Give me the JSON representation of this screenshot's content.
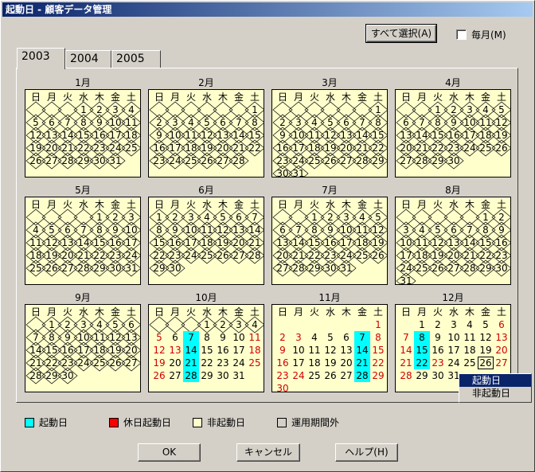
{
  "window": {
    "title": "起動日 - 顧客データ管理"
  },
  "toolbar": {
    "select_all_label": "すべて選択(A)",
    "monthly_label": "毎月(M)"
  },
  "tabs": [
    "2003",
    "2004",
    "2005"
  ],
  "weekdays": [
    "日",
    "月",
    "火",
    "水",
    "木",
    "金",
    "土"
  ],
  "months": [
    {
      "label": "1月",
      "start": 3,
      "days": 31,
      "active": false
    },
    {
      "label": "2月",
      "start": 6,
      "days": 28,
      "active": false
    },
    {
      "label": "3月",
      "start": 6,
      "days": 31,
      "active": false
    },
    {
      "label": "4月",
      "start": 2,
      "days": 30,
      "active": false
    },
    {
      "label": "5月",
      "start": 4,
      "days": 31,
      "active": false
    },
    {
      "label": "6月",
      "start": 0,
      "days": 30,
      "active": false
    },
    {
      "label": "7月",
      "start": 2,
      "days": 31,
      "active": false
    },
    {
      "label": "8月",
      "start": 5,
      "days": 31,
      "active": false
    },
    {
      "label": "9月",
      "start": 1,
      "days": 30,
      "active": false
    },
    {
      "label": "10月",
      "start": 3,
      "days": 31,
      "active": true,
      "crossed_until": 4,
      "on": [
        7,
        14,
        21,
        28
      ],
      "holidays": [
        13
      ]
    },
    {
      "label": "11月",
      "start": 6,
      "days": 30,
      "active": true,
      "crossed_until": 0,
      "on": [
        7,
        14,
        21,
        28
      ],
      "holidays": [
        3,
        24
      ]
    },
    {
      "label": "12月",
      "start": 1,
      "days": 31,
      "active": true,
      "crossed_until": 0,
      "on": [
        8,
        15,
        22
      ],
      "holidays": [
        23
      ],
      "today": 26
    }
  ],
  "context_menu": {
    "items": [
      "起動日",
      "非起動日"
    ],
    "selected": 0
  },
  "legend": [
    {
      "label": "起動日",
      "color": "#00ffff"
    },
    {
      "label": "休日起動日",
      "color": "#ff0000"
    },
    {
      "label": "非起動日",
      "color": "#ffffcc"
    },
    {
      "label": "運用期間外",
      "color": "#d4d0c8"
    }
  ],
  "buttons": {
    "ok": "OK",
    "cancel": "キャンセル",
    "help": "ヘルプ(H)"
  }
}
